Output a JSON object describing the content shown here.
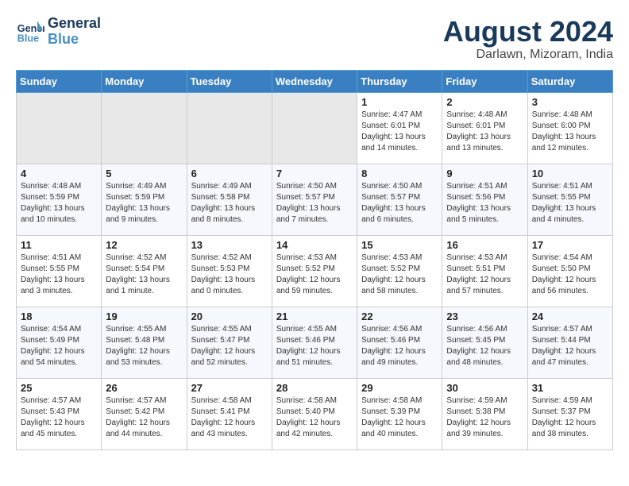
{
  "header": {
    "logo_line1": "General",
    "logo_line2": "Blue",
    "month_title": "August 2024",
    "location": "Darlawn, Mizoram, India"
  },
  "weekdays": [
    "Sunday",
    "Monday",
    "Tuesday",
    "Wednesday",
    "Thursday",
    "Friday",
    "Saturday"
  ],
  "weeks": [
    [
      {
        "day": "",
        "info": ""
      },
      {
        "day": "",
        "info": ""
      },
      {
        "day": "",
        "info": ""
      },
      {
        "day": "",
        "info": ""
      },
      {
        "day": "1",
        "info": "Sunrise: 4:47 AM\nSunset: 6:01 PM\nDaylight: 13 hours\nand 14 minutes."
      },
      {
        "day": "2",
        "info": "Sunrise: 4:48 AM\nSunset: 6:01 PM\nDaylight: 13 hours\nand 13 minutes."
      },
      {
        "day": "3",
        "info": "Sunrise: 4:48 AM\nSunset: 6:00 PM\nDaylight: 13 hours\nand 12 minutes."
      }
    ],
    [
      {
        "day": "4",
        "info": "Sunrise: 4:48 AM\nSunset: 5:59 PM\nDaylight: 13 hours\nand 10 minutes."
      },
      {
        "day": "5",
        "info": "Sunrise: 4:49 AM\nSunset: 5:59 PM\nDaylight: 13 hours\nand 9 minutes."
      },
      {
        "day": "6",
        "info": "Sunrise: 4:49 AM\nSunset: 5:58 PM\nDaylight: 13 hours\nand 8 minutes."
      },
      {
        "day": "7",
        "info": "Sunrise: 4:50 AM\nSunset: 5:57 PM\nDaylight: 13 hours\nand 7 minutes."
      },
      {
        "day": "8",
        "info": "Sunrise: 4:50 AM\nSunset: 5:57 PM\nDaylight: 13 hours\nand 6 minutes."
      },
      {
        "day": "9",
        "info": "Sunrise: 4:51 AM\nSunset: 5:56 PM\nDaylight: 13 hours\nand 5 minutes."
      },
      {
        "day": "10",
        "info": "Sunrise: 4:51 AM\nSunset: 5:55 PM\nDaylight: 13 hours\nand 4 minutes."
      }
    ],
    [
      {
        "day": "11",
        "info": "Sunrise: 4:51 AM\nSunset: 5:55 PM\nDaylight: 13 hours\nand 3 minutes."
      },
      {
        "day": "12",
        "info": "Sunrise: 4:52 AM\nSunset: 5:54 PM\nDaylight: 13 hours\nand 1 minute."
      },
      {
        "day": "13",
        "info": "Sunrise: 4:52 AM\nSunset: 5:53 PM\nDaylight: 13 hours\nand 0 minutes."
      },
      {
        "day": "14",
        "info": "Sunrise: 4:53 AM\nSunset: 5:52 PM\nDaylight: 12 hours\nand 59 minutes."
      },
      {
        "day": "15",
        "info": "Sunrise: 4:53 AM\nSunset: 5:52 PM\nDaylight: 12 hours\nand 58 minutes."
      },
      {
        "day": "16",
        "info": "Sunrise: 4:53 AM\nSunset: 5:51 PM\nDaylight: 12 hours\nand 57 minutes."
      },
      {
        "day": "17",
        "info": "Sunrise: 4:54 AM\nSunset: 5:50 PM\nDaylight: 12 hours\nand 56 minutes."
      }
    ],
    [
      {
        "day": "18",
        "info": "Sunrise: 4:54 AM\nSunset: 5:49 PM\nDaylight: 12 hours\nand 54 minutes."
      },
      {
        "day": "19",
        "info": "Sunrise: 4:55 AM\nSunset: 5:48 PM\nDaylight: 12 hours\nand 53 minutes."
      },
      {
        "day": "20",
        "info": "Sunrise: 4:55 AM\nSunset: 5:47 PM\nDaylight: 12 hours\nand 52 minutes."
      },
      {
        "day": "21",
        "info": "Sunrise: 4:55 AM\nSunset: 5:46 PM\nDaylight: 12 hours\nand 51 minutes."
      },
      {
        "day": "22",
        "info": "Sunrise: 4:56 AM\nSunset: 5:46 PM\nDaylight: 12 hours\nand 49 minutes."
      },
      {
        "day": "23",
        "info": "Sunrise: 4:56 AM\nSunset: 5:45 PM\nDaylight: 12 hours\nand 48 minutes."
      },
      {
        "day": "24",
        "info": "Sunrise: 4:57 AM\nSunset: 5:44 PM\nDaylight: 12 hours\nand 47 minutes."
      }
    ],
    [
      {
        "day": "25",
        "info": "Sunrise: 4:57 AM\nSunset: 5:43 PM\nDaylight: 12 hours\nand 45 minutes."
      },
      {
        "day": "26",
        "info": "Sunrise: 4:57 AM\nSunset: 5:42 PM\nDaylight: 12 hours\nand 44 minutes."
      },
      {
        "day": "27",
        "info": "Sunrise: 4:58 AM\nSunset: 5:41 PM\nDaylight: 12 hours\nand 43 minutes."
      },
      {
        "day": "28",
        "info": "Sunrise: 4:58 AM\nSunset: 5:40 PM\nDaylight: 12 hours\nand 42 minutes."
      },
      {
        "day": "29",
        "info": "Sunrise: 4:58 AM\nSunset: 5:39 PM\nDaylight: 12 hours\nand 40 minutes."
      },
      {
        "day": "30",
        "info": "Sunrise: 4:59 AM\nSunset: 5:38 PM\nDaylight: 12 hours\nand 39 minutes."
      },
      {
        "day": "31",
        "info": "Sunrise: 4:59 AM\nSunset: 5:37 PM\nDaylight: 12 hours\nand 38 minutes."
      }
    ]
  ]
}
